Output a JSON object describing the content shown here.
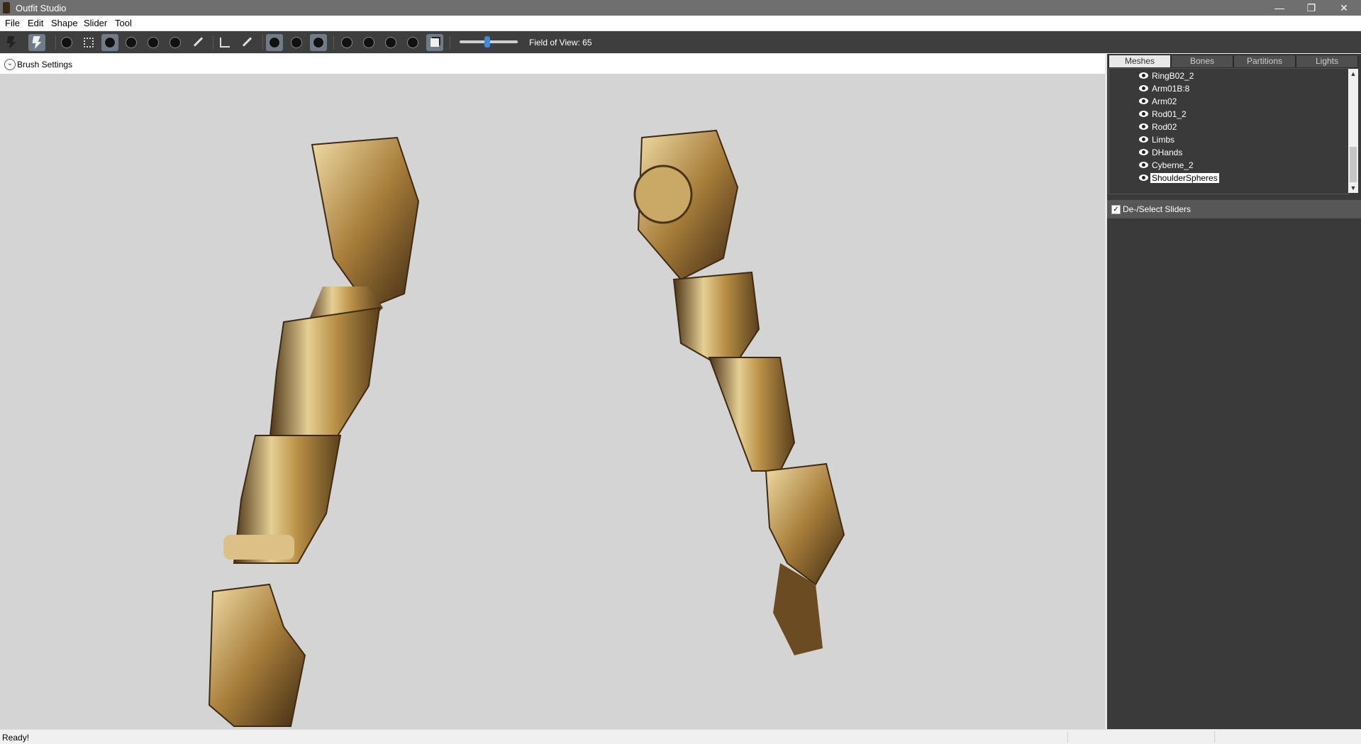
{
  "window": {
    "title": "Outfit Studio",
    "minimize": "—",
    "restore": "❐",
    "close": "✕"
  },
  "menu": [
    "File",
    "Edit",
    "Shape",
    "Slider",
    "Tool"
  ],
  "toolbar": {
    "fov_label": "Field of View: 65",
    "fov_value": 65
  },
  "brush": {
    "toggle": "⌄",
    "label": "Brush Settings"
  },
  "panel": {
    "tabs": [
      "Meshes",
      "Bones",
      "Partitions",
      "Lights"
    ],
    "active_tab": "Meshes",
    "meshes": [
      "RingB02_2",
      "Arm01B:8",
      "Arm02",
      "Rod01_2",
      "Rod02",
      "Limbs",
      "DHands",
      "Cyberne_2",
      "ShoulderSpheres"
    ],
    "selected_mesh": "ShoulderSpheres",
    "scroll_up": "▲",
    "scroll_down": "▼",
    "sliders_check": "✓",
    "sliders_label": "De-/Select Sliders"
  },
  "status": {
    "text": "Ready!"
  },
  "colors": {
    "accent": "#3a8be0",
    "metal_light": "#e6cf94",
    "metal_mid": "#b88f45",
    "metal_dark": "#4c3418"
  }
}
